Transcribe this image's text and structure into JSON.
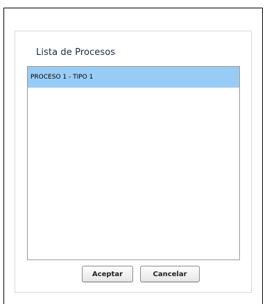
{
  "dialog": {
    "title": "Lista de Procesos",
    "list_items": [
      {
        "label": "PROCESO 1 - TIPO 1",
        "selected": true
      }
    ],
    "accept_label": "Aceptar",
    "cancel_label": "Cancelar"
  },
  "colors": {
    "selection": "#99ccf5",
    "title_text": "#1a2b3c",
    "list_border": "#9a9a9a"
  }
}
